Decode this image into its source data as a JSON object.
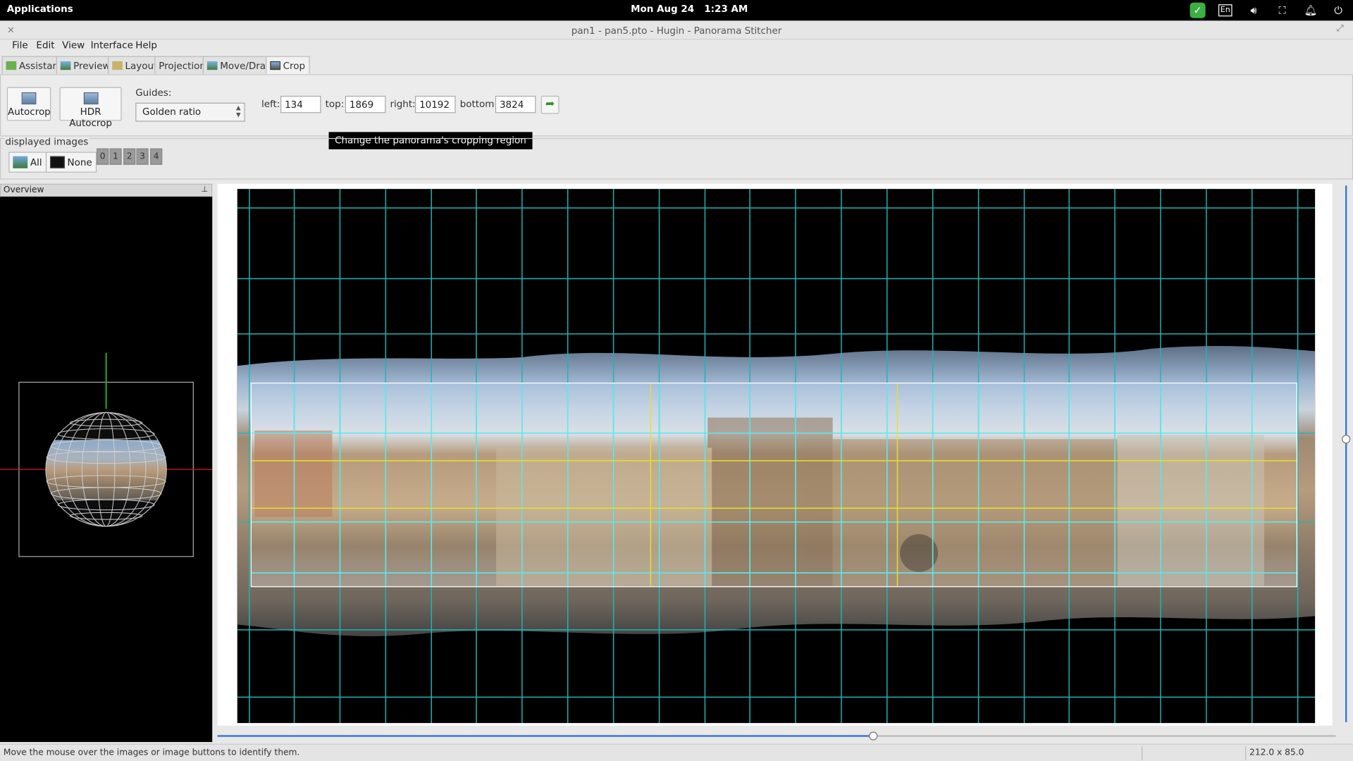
{
  "topbar": {
    "applications": "Applications",
    "date": "Mon Aug 24",
    "time": "1:23 AM",
    "keyboard": "En",
    "icons": [
      "checkmark-badge-icon",
      "keyboard-layout-icon",
      "volume-icon",
      "network-icon",
      "bell-icon",
      "power-icon"
    ]
  },
  "window": {
    "title": "pan1 - pan5.pto - Hugin - Panorama Stitcher"
  },
  "menu": {
    "items": [
      "File",
      "Edit",
      "View",
      "Interface",
      "Help"
    ]
  },
  "tabs": [
    {
      "label": "Assistant",
      "icon": "assistant-icon"
    },
    {
      "label": "Preview",
      "icon": "preview-icon"
    },
    {
      "label": "Layout",
      "icon": "layout-icon"
    },
    {
      "label": "Projection",
      "icon": ""
    },
    {
      "label": "Move/Drag",
      "icon": "move-drag-icon"
    },
    {
      "label": "Crop",
      "icon": "crop-icon"
    }
  ],
  "crop_panel": {
    "autocrop": "Autocrop",
    "hdr_autocrop": "HDR Autocrop",
    "guides_label": "Guides:",
    "guides_value": "Golden ratio",
    "left_label": "left:",
    "left_value": "134",
    "top_label": "top:",
    "top_value": "1869",
    "right_label": "right:",
    "right_value": "10192",
    "bottom_label": "bottom:",
    "bottom_value": "3824",
    "tooltip": "Change the panorama's cropping region"
  },
  "displayed_images": {
    "label": "displayed images",
    "all": "All",
    "none": "None",
    "numbers": [
      "0",
      "1",
      "2",
      "3",
      "4"
    ]
  },
  "overview": {
    "title": "Overview"
  },
  "statusbar": {
    "message": "Move the mouse over the images or image buttons to identify them.",
    "size": "212.0 x 85.0"
  },
  "colors": {
    "grid": "#1fb5b5",
    "crop_grid": "#5fe8ec",
    "guide": "#e8e02a",
    "accent_scroll": "#3b7bd4"
  },
  "scroll": {
    "horizontal_position": 0.59,
    "vertical_position": 0.47
  }
}
